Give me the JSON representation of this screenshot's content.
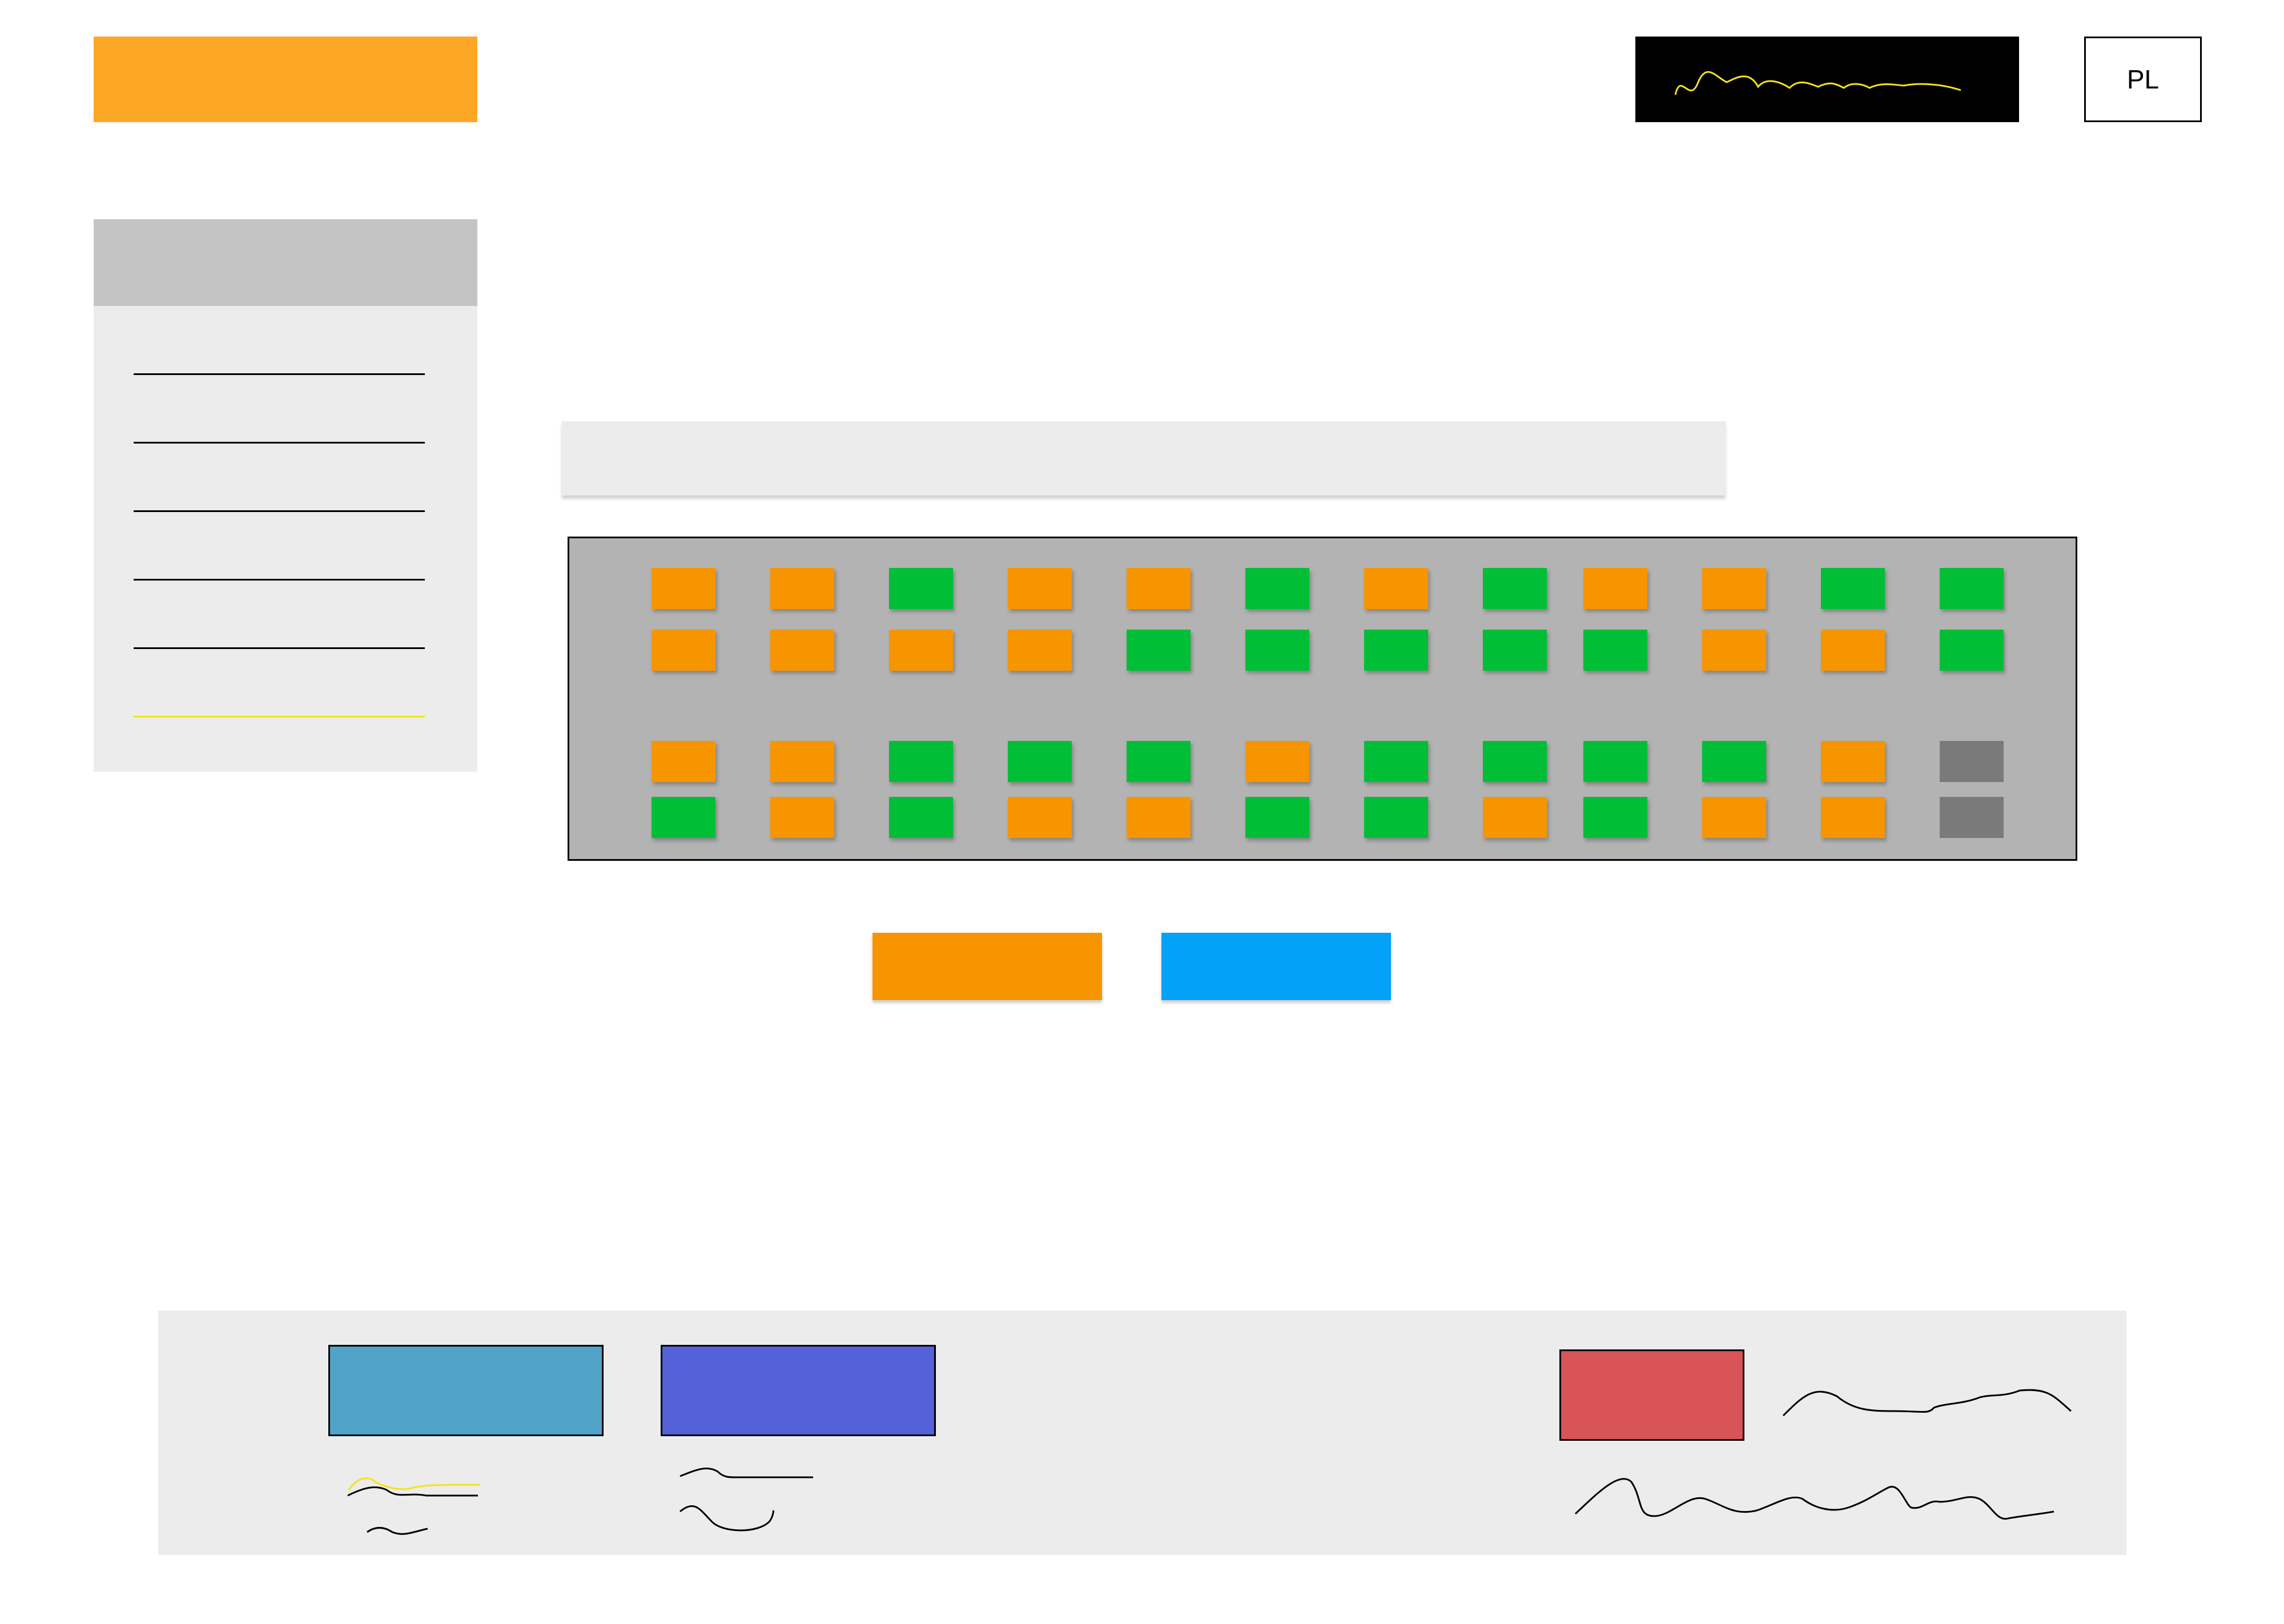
{
  "colors": {
    "brand_orange": "#fca726",
    "seat_orange": "#f79500",
    "seat_green": "#00bf36",
    "seat_grey": "#7a7a7a",
    "button_orange": "#f79500",
    "button_blue": "#03a1f8",
    "footer_teal": "#52a3c8",
    "footer_indigo": "#5461d8",
    "footer_red": "#d85457",
    "highlight_yellow": "#f2e41c",
    "rule_black": "#000000"
  },
  "header": {
    "logo_icon": "logo-placeholder",
    "signature_icon": "handwritten-signature",
    "language_label": "PL"
  },
  "sidebar": {
    "item_count_visible": 6,
    "active_item_color": "#f2e41c"
  },
  "seat_map": {
    "status_legend": [
      "available",
      "taken",
      "unavailable"
    ],
    "rows": [
      [
        "taken",
        "taken",
        "available",
        "taken",
        "taken",
        "available",
        "taken",
        "available",
        "taken",
        "taken",
        "available",
        "available"
      ],
      [
        "taken",
        "taken",
        "taken",
        "taken",
        "available",
        "available",
        "available",
        "available",
        "available",
        "taken",
        "taken",
        "available"
      ],
      [
        "taken",
        "taken",
        "available",
        "available",
        "available",
        "taken",
        "available",
        "available",
        "available",
        "available",
        "taken",
        "unavailable"
      ],
      [
        "available",
        "taken",
        "available",
        "taken",
        "taken",
        "available",
        "available",
        "taken",
        "available",
        "taken",
        "taken",
        "unavailable"
      ]
    ]
  },
  "actions": {
    "left_button_color": "#f79500",
    "right_button_color": "#03a1f8"
  },
  "footer": {
    "box_colors": [
      "#52a3c8",
      "#5461d8",
      "#d85457"
    ]
  }
}
